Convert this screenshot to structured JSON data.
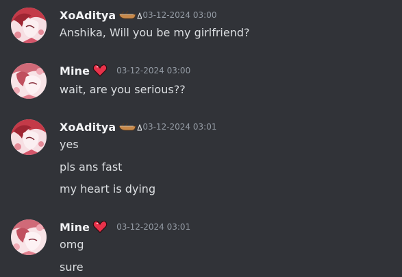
{
  "messages": [
    {
      "username": "XoAditya",
      "timestamp": "03-12-2024 03:00",
      "lines": [
        "Anshika, Will you be my girlfriend?"
      ]
    },
    {
      "username": "Mine",
      "timestamp": "03-12-2024 03:00",
      "lines": [
        "wait, are you serious??"
      ]
    },
    {
      "username": "XoAditya",
      "timestamp": "03-12-2024 03:01",
      "lines": [
        "yes",
        "pls ans fast",
        "my heart is dying"
      ]
    },
    {
      "username": "Mine",
      "timestamp": "03-12-2024 03:01",
      "lines": [
        "omg",
        "sure"
      ]
    }
  ],
  "icons": {
    "xoaditya_badge": "canoe-triangle-icon",
    "mine_badge": "heart-icon"
  },
  "colors": {
    "background": "#313338",
    "username": "#f2f3f5",
    "message_text": "#dbdee1",
    "timestamp": "#949ba4",
    "heart": "#e8324a"
  }
}
